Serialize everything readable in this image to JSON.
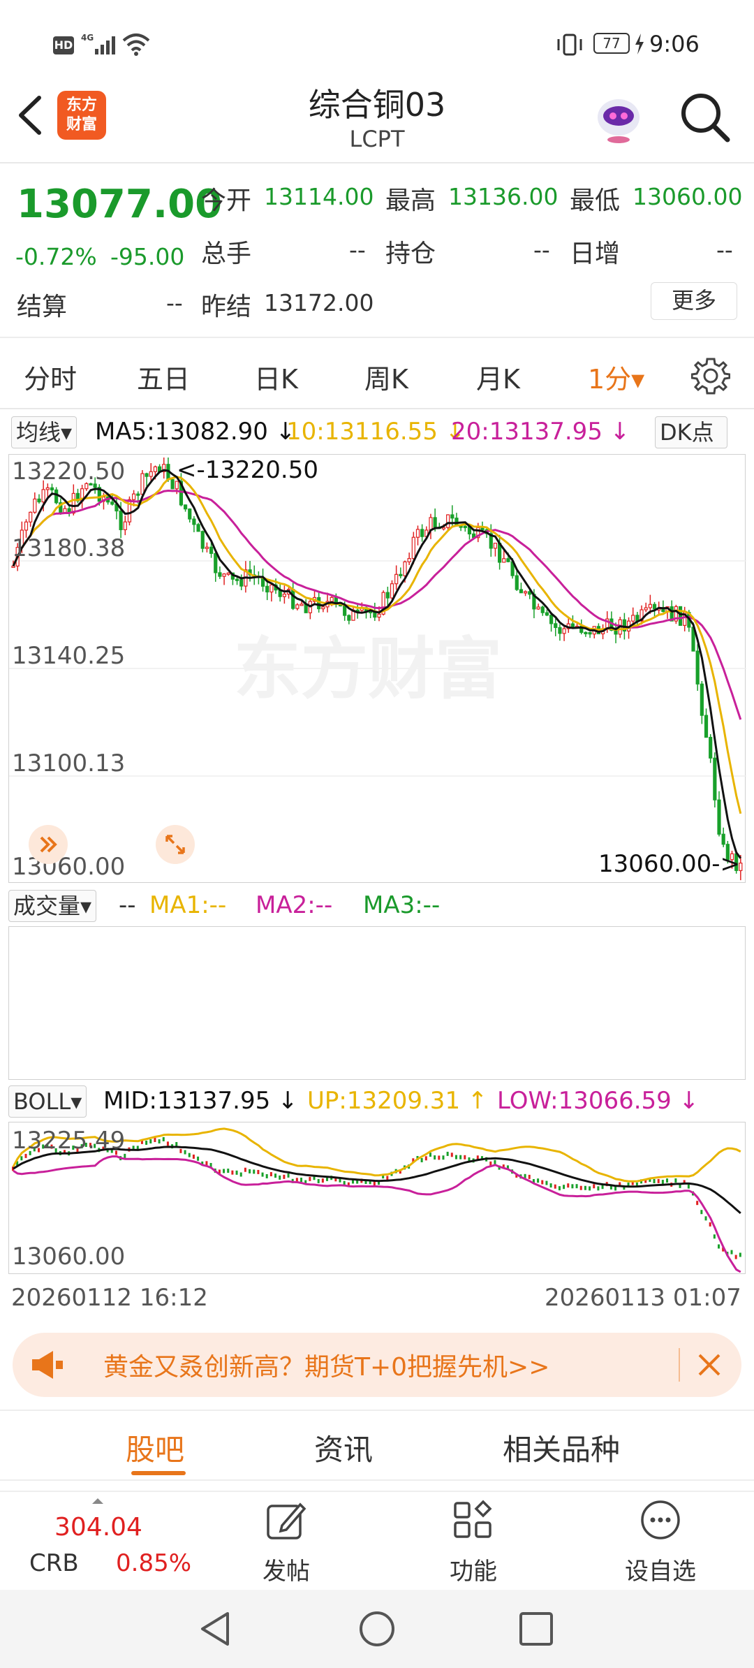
{
  "status_bar": {
    "left_badges": [
      "HD",
      "46"
    ],
    "battery": "77",
    "time": "9:06"
  },
  "header": {
    "logo_text": "东方\n财富",
    "title": "综合铜03",
    "subtitle": "LCPT"
  },
  "quote": {
    "last_price": "13077.00",
    "change_pct": "-0.72%",
    "change_abs": "-95.00",
    "settle_label": "结算",
    "settle_value": "--",
    "open_label": "今开",
    "open_value": "13114.00",
    "high_label": "最高",
    "high_value": "13136.00",
    "low_label": "最低",
    "low_value": "13060.00",
    "volume_label": "总手",
    "volume_value": "--",
    "position_label": "持仓",
    "position_value": "--",
    "daily_inc_label": "日增",
    "daily_inc_value": "--",
    "prev_settle_label": "昨结",
    "prev_settle_value": "13172.00",
    "more_label": "更多"
  },
  "period_tabs": [
    {
      "label": "分时",
      "active": false
    },
    {
      "label": "五日",
      "active": false
    },
    {
      "label": "日K",
      "active": false
    },
    {
      "label": "周K",
      "active": false
    },
    {
      "label": "月K",
      "active": false
    },
    {
      "label": "1分▾",
      "active": true
    }
  ],
  "main_chart": {
    "indicator_select": "均线▾",
    "ma5": "MA5:13082.90",
    "ma10": "10:13116.55",
    "ma20": "20:13137.95",
    "dk_label": "DK点",
    "y_ticks": [
      "13220.50",
      "13180.38",
      "13140.25",
      "13100.13",
      "13060.00"
    ],
    "high_marker": "<-13220.50",
    "low_marker": "13060.00->",
    "watermark": "东方财富",
    "colors": {
      "up": "#e02020",
      "down": "#18a02a",
      "ma5": "#111111",
      "ma10": "#e8b400",
      "ma20": "#c8209a"
    }
  },
  "volume_panel": {
    "select": "成交量▾",
    "dash": "--",
    "ma1": "MA1:--",
    "ma2": "MA2:--",
    "ma3": "MA3:--"
  },
  "boll_panel": {
    "select": "BOLL▾",
    "mid": "MID:13137.95",
    "up": "UP:13209.31",
    "low": "LOW:13066.59",
    "y_top": "13225.49",
    "y_bottom": "13060.00",
    "time_start": "20260112 16:12",
    "time_end": "20260113 01:07"
  },
  "banner": {
    "text": "黄金又叒创新高？期货T+0把握先机>>"
  },
  "sub_tabs": [
    {
      "label": "股吧",
      "active": true
    },
    {
      "label": "资讯",
      "active": false
    },
    {
      "label": "相关品种",
      "active": false
    }
  ],
  "bottom_nav": {
    "index_value": "304.04",
    "index_name": "CRB",
    "index_change": "0.85%",
    "post_label": "发帖",
    "functions_label": "功能",
    "watchlist_label": "设自选"
  }
}
